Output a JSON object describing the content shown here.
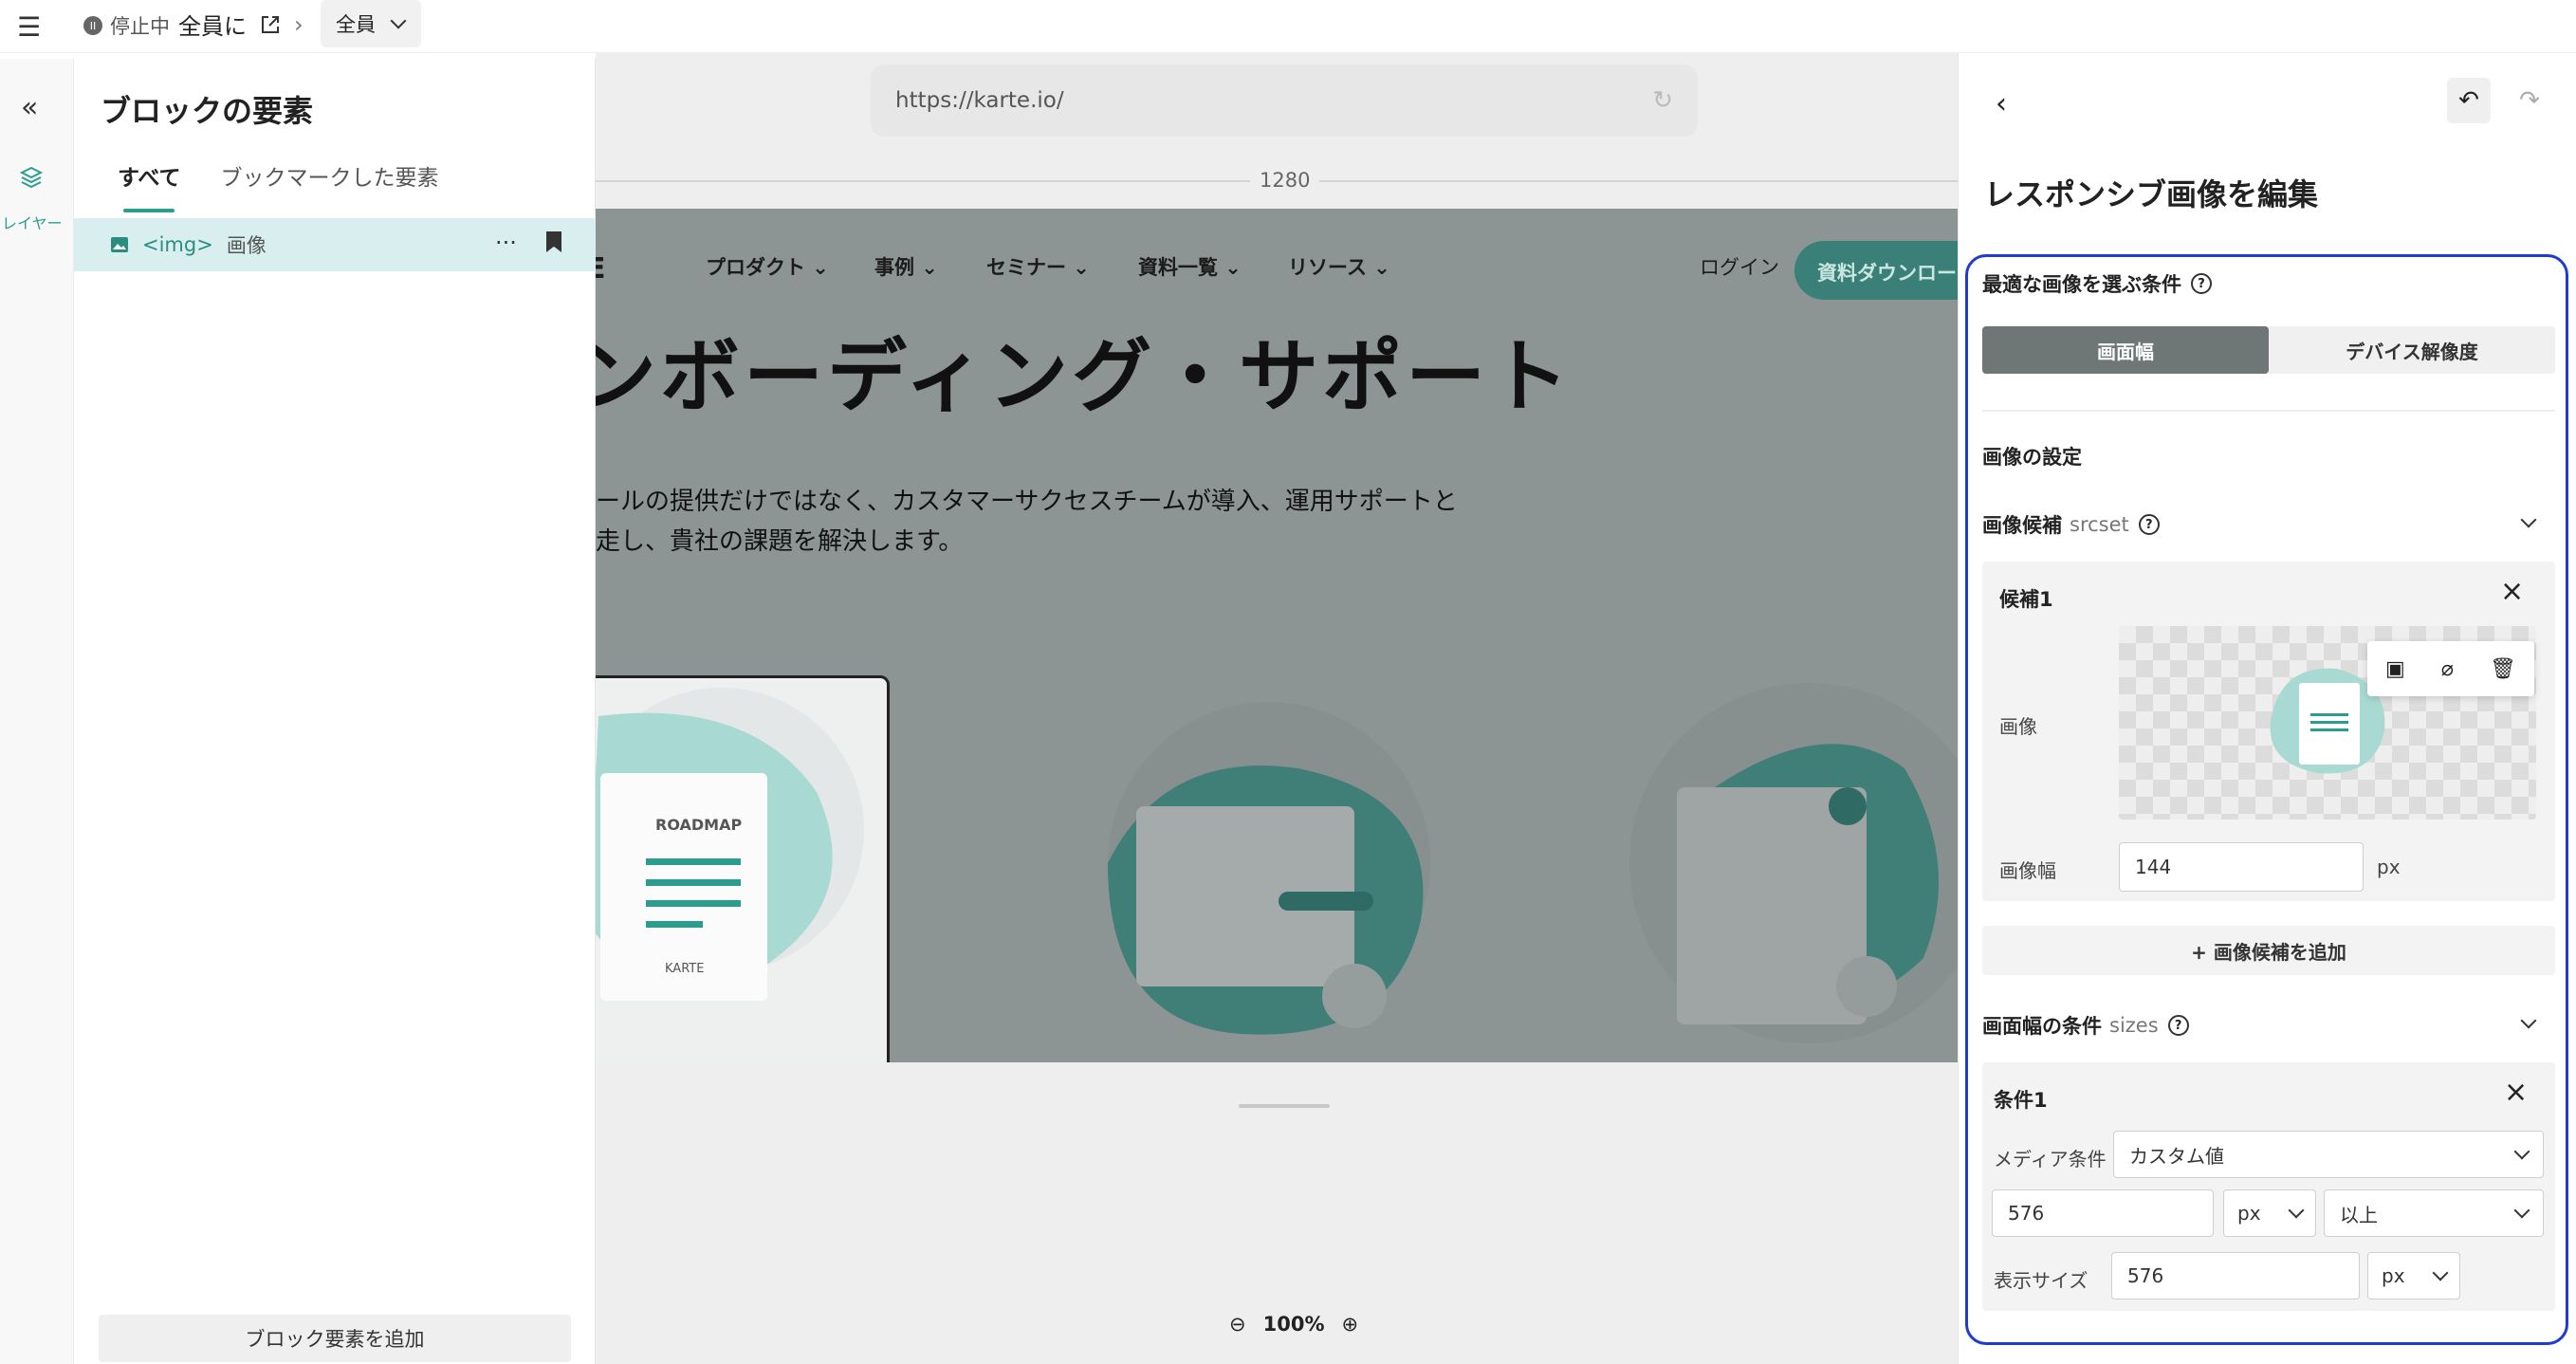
{
  "topbar": {
    "menu_icon": "hamburger-icon",
    "status": "停止中",
    "title": "全員に",
    "audience_select": "全員"
  },
  "rail": {
    "layers_label": "レイヤー"
  },
  "left_panel": {
    "title": "ブロックの要素",
    "tabs": [
      {
        "label": "すべて",
        "active": true
      },
      {
        "label": "ブックマークした要素",
        "active": false
      }
    ],
    "elements": [
      {
        "tag": "<img>",
        "label": "画像"
      }
    ],
    "add_button": "ブロック要素を追加"
  },
  "canvas": {
    "url": "https://karte.io/",
    "ruler_width": "1280",
    "zoom": "100%",
    "preview": {
      "nav": [
        "プロダクト",
        "事例",
        "セミナー",
        "資料一覧",
        "リソース"
      ],
      "login": "ログイン",
      "download_button": "資料ダウンロード",
      "hero": "ンボーディング・サポート",
      "subtext_line1": "ールの提供だけではなく、カスタマーサクセスチームが導入、運用サポートと",
      "subtext_line2": "走し、貴社の課題を解決します。",
      "roadmap_label": "ROADMAP",
      "karte_label": "KARTE"
    }
  },
  "right_panel": {
    "title": "レスポンシブ画像を編集",
    "condition_section": "最適な画像を選ぶ条件",
    "segment": {
      "option1": "画面幅",
      "option2": "デバイス解像度",
      "selected": "画面幅"
    },
    "image_settings": "画像の設定",
    "srcset_label": "画像候補",
    "srcset_code": "srcset",
    "candidate": {
      "title": "候補1",
      "image_label": "画像",
      "width_label": "画像幅",
      "width_value": "144",
      "unit": "px"
    },
    "add_candidate": "+ 画像候補を追加",
    "sizes_label": "画面幅の条件",
    "sizes_code": "sizes",
    "condition": {
      "title": "条件1",
      "media_label": "メディア条件",
      "media_value": "カスタム値",
      "value": "576",
      "unit": "px",
      "compare": "以上",
      "display_label": "表示サイズ",
      "display_value": "576",
      "display_unit": "px"
    }
  },
  "colors": {
    "accent": "#2a9d8f",
    "highlight_border": "#1f3bd3",
    "selected_row": "#d9efef"
  }
}
